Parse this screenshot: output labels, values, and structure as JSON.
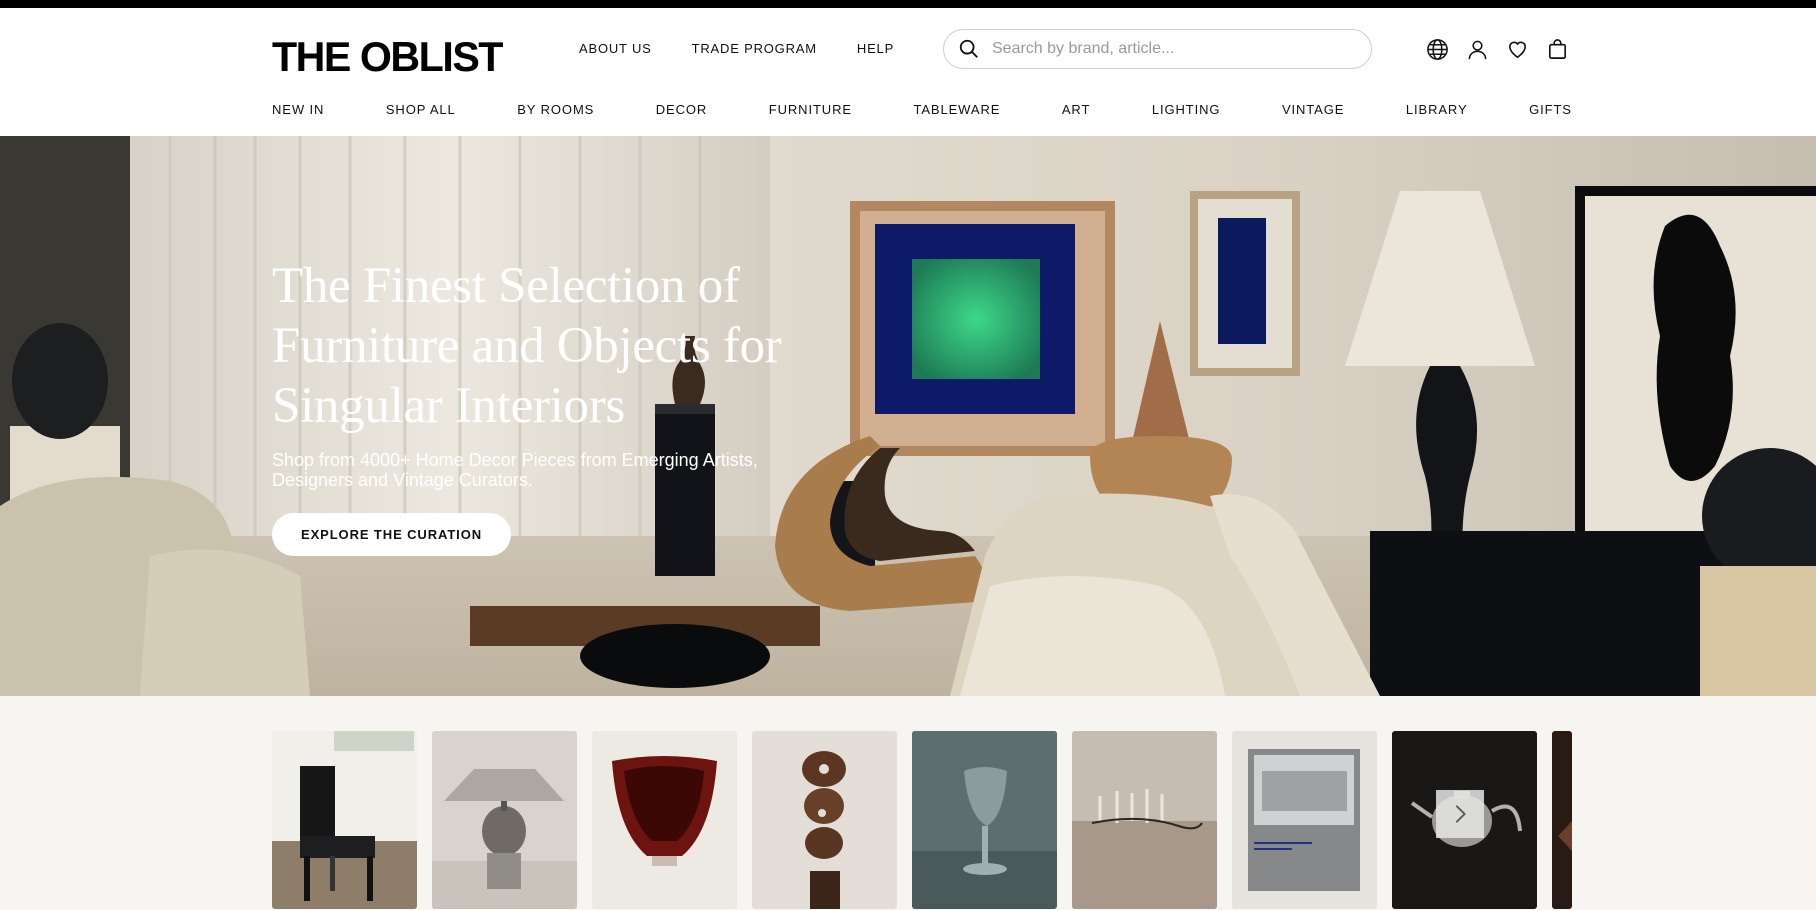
{
  "brand": {
    "logo": "THE OBLIST"
  },
  "top_links": [
    "ABOUT US",
    "TRADE PROGRAM",
    "HELP"
  ],
  "search": {
    "placeholder": "Search by brand, article..."
  },
  "header_icons": [
    "globe-icon",
    "account-icon",
    "heart-icon",
    "bag-icon"
  ],
  "nav": [
    "NEW IN",
    "SHOP ALL",
    "BY ROOMS",
    "DECOR",
    "FURNITURE",
    "TABLEWARE",
    "ART",
    "LIGHTING",
    "VINTAGE",
    "LIBRARY",
    "GIFTS"
  ],
  "hero": {
    "title": "The Finest Selection of Furniture and Objects for Singular Interiors",
    "subtitle": "Shop from 4000+ Home Decor Pieces from Emerging Artists, Designers and Vintage Curators.",
    "cta": "EXPLORE THE CURATION"
  },
  "carousel": {
    "items": [
      "black-chair",
      "chrome-table-lamp",
      "red-glass-vase",
      "wood-sculpture",
      "glass-goblet",
      "candelabra",
      "architecture-book",
      "silver-teapot",
      "partial-item"
    ],
    "next_icon": "chevron-right-icon"
  },
  "colors": {
    "text": "#111111",
    "accent": "#000000",
    "strip_bg": "#f6f5f1"
  }
}
